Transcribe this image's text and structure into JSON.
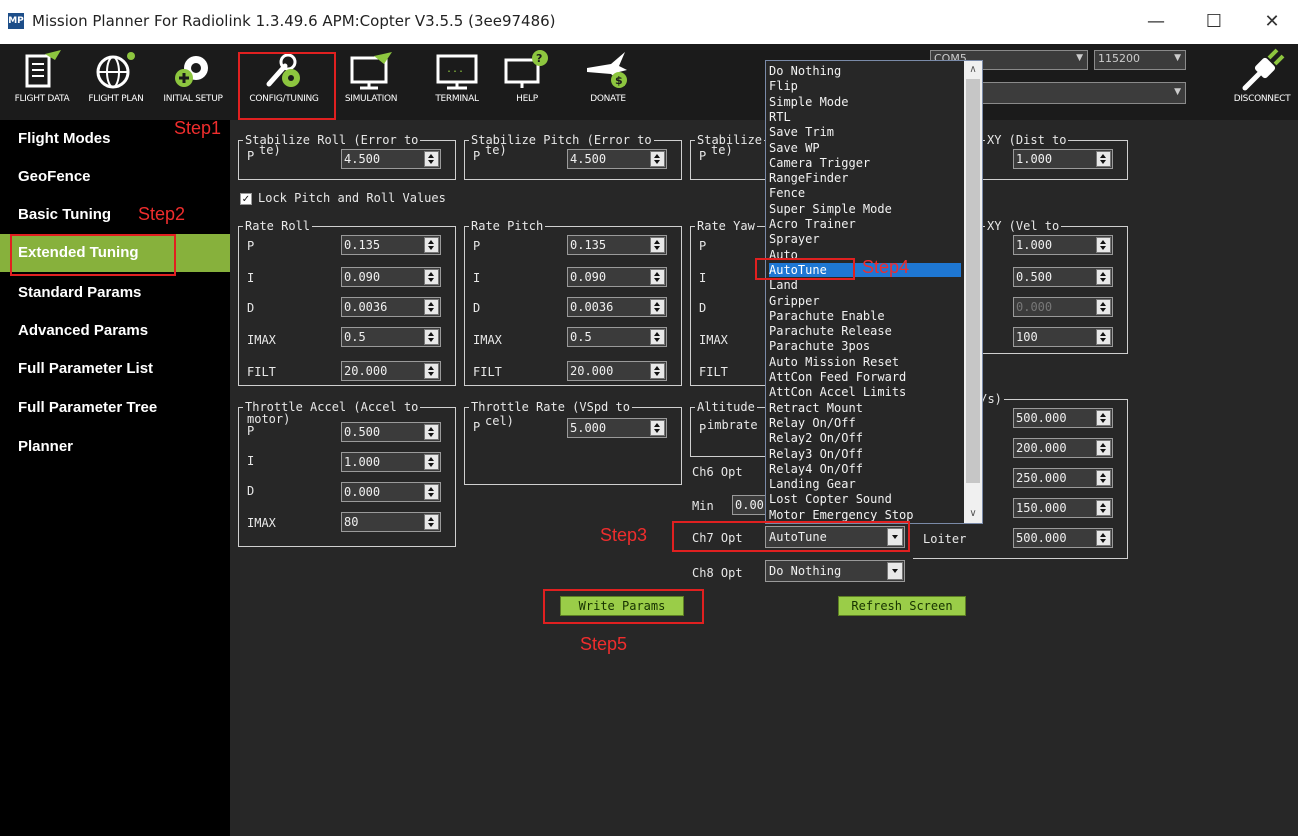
{
  "window": {
    "app_icon": "MP",
    "title": "Mission Planner For Radiolink 1.3.49.6 APM:Copter V3.5.5 (3ee97486)",
    "minimize": "—",
    "maximize": "☐",
    "close": "✕"
  },
  "toolbar": {
    "flight_data": "FLIGHT DATA",
    "flight_plan": "FLIGHT PLAN",
    "initial_setup": "INITIAL SETUP",
    "config_tuning": "CONFIG/TUNING",
    "simulation": "SIMULATION",
    "terminal": "TERMINAL",
    "help": "HELP",
    "donate": "DONATE",
    "disconnect": "DISCONNECT",
    "com_port": "COM5",
    "baud": "115200"
  },
  "sidebar": {
    "items": [
      {
        "label": "Flight Modes"
      },
      {
        "label": "GeoFence"
      },
      {
        "label": "Basic Tuning"
      },
      {
        "label": "Extended Tuning"
      },
      {
        "label": "Standard Params"
      },
      {
        "label": "Advanced Params"
      },
      {
        "label": "Full Parameter List"
      },
      {
        "label": "Full Parameter Tree"
      },
      {
        "label": "Planner"
      }
    ]
  },
  "steps": {
    "s1": "Step1",
    "s2": "Step2",
    "s3": "Step3",
    "s4": "Step4",
    "s5": "Step5"
  },
  "stab_roll": {
    "title": "Stabilize Roll (Error to",
    "p_label": "P",
    "extra": "te)",
    "value": "4.500"
  },
  "stab_pitch": {
    "title": "Stabilize Pitch (Error to",
    "p_label": "P",
    "extra": "te)",
    "value": "4.500"
  },
  "stab_yaw": {
    "title": "Stabilize",
    "p_label": "P",
    "extra": "te)"
  },
  "loiter_pos": {
    "title": "XY (Dist to",
    "value": "1.000"
  },
  "lock_label": "Lock Pitch and Roll Values",
  "rate_roll": {
    "title": "Rate Roll",
    "p": "0.135",
    "i": "0.090",
    "d": "0.0036",
    "imax": "0.5",
    "filt": "20.000"
  },
  "rate_pitch": {
    "title": "Rate Pitch",
    "p": "0.135",
    "i": "0.090",
    "d": "0.0036",
    "imax": "0.5",
    "filt": "20.000"
  },
  "rate_yaw": {
    "title": "Rate Yaw"
  },
  "pid_labels": {
    "p": "P",
    "i": "I",
    "d": "D",
    "imax": "IMAX",
    "filt": "FILT"
  },
  "velocity_xy": {
    "title": "XY (Vel to",
    "p": "1.000",
    "i": "0.500",
    "d": "0.000",
    "imax": "100"
  },
  "throttle_accel": {
    "title": "Throttle Accel (Accel to",
    "subtitle": "motor)",
    "p": "0.500",
    "i": "1.000",
    "d": "0.000",
    "imax": "80"
  },
  "throttle_rate": {
    "title": "Throttle Rate (VSpd to",
    "p_label": "P",
    "extra": "cel)",
    "value": "5.000"
  },
  "altitude": {
    "title": "Altitude",
    "p_label": "P",
    "extra": "imbrate"
  },
  "wpnav": {
    "title": "m/s)",
    "v1": "500.000",
    "v2": "200.000",
    "v3": "250.000",
    "v4": "150.000",
    "v5": "500.000",
    "loiter_label": "Loiter"
  },
  "channel_opts": {
    "ch6_label": "Ch6 Opt",
    "min_label": "Min",
    "min_value": "0.00",
    "ch7_label": "Ch7 Opt",
    "ch7_value": "AutoTune",
    "ch8_label": "Ch8 Opt",
    "ch8_value": "Do Nothing"
  },
  "buttons": {
    "write_params": "Write Params",
    "refresh_screen": "Refresh Screen"
  },
  "dropdown": {
    "options": [
      "Do Nothing",
      "Flip",
      "Simple Mode",
      "RTL",
      "Save Trim",
      "Save WP",
      "Camera Trigger",
      "RangeFinder",
      "Fence",
      "Super Simple Mode",
      "Acro Trainer",
      "Sprayer",
      "Auto",
      "AutoTune",
      "Land",
      "Gripper",
      "Parachute Enable",
      "Parachute Release",
      "Parachute 3pos",
      "Auto Mission Reset",
      "AttCon Feed Forward",
      "AttCon Accel Limits",
      "Retract Mount",
      "Relay On/Off",
      "Relay2 On/Off",
      "Relay3 On/Off",
      "Relay4 On/Off",
      "Landing Gear",
      "Lost Copter Sound",
      "Motor Emergency Stop"
    ],
    "selected": "AutoTune",
    "scroll_up": "∧",
    "scroll_down": "∨"
  },
  "colors": {
    "accent": "#87b13c",
    "selection": "#1e77d3",
    "step_red": "#e02020"
  }
}
